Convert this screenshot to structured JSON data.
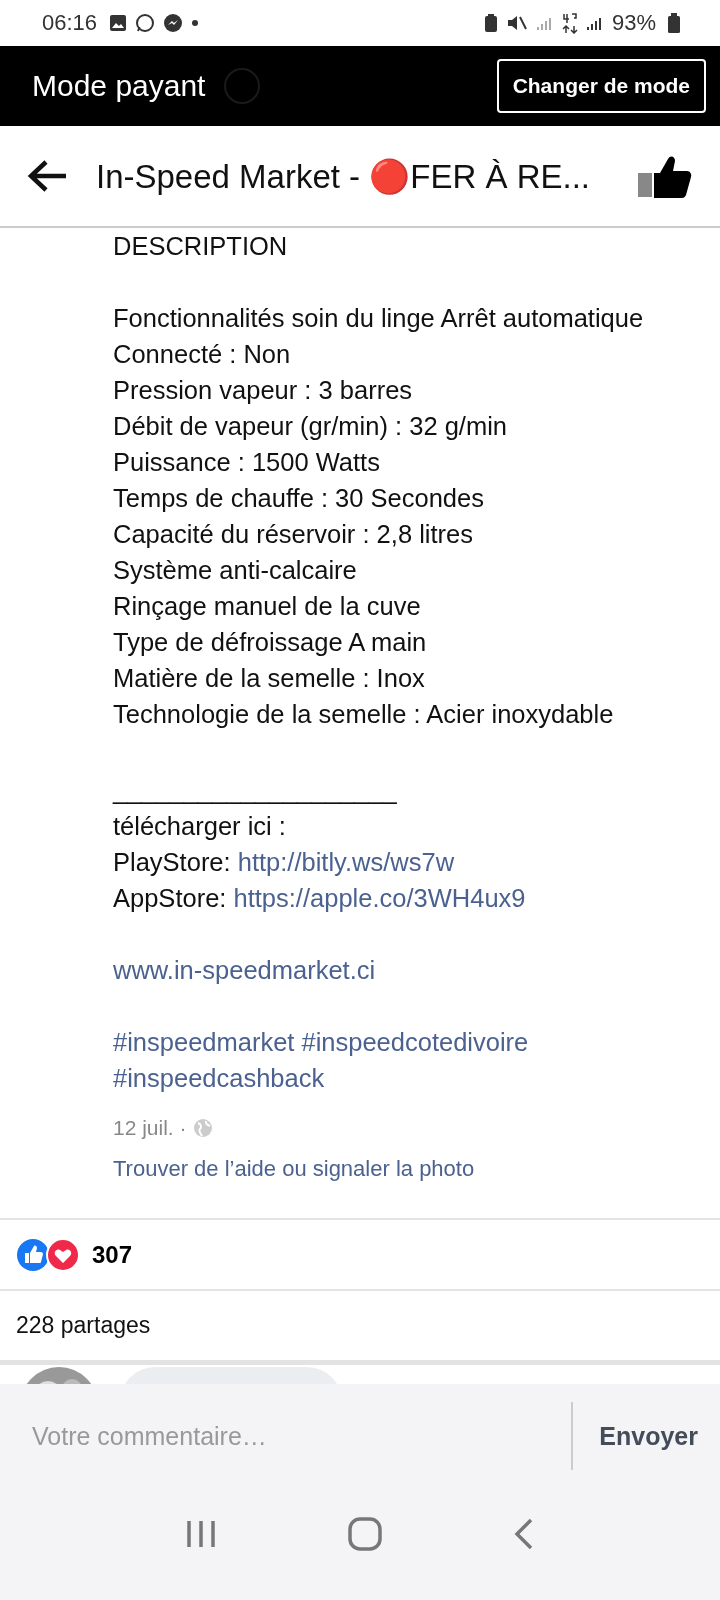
{
  "status_bar": {
    "time": "06:16",
    "battery": "93%"
  },
  "mode_bar": {
    "title": "Mode payant",
    "button": "Changer de mode"
  },
  "header": {
    "title": "In-Speed Market - 🔴FER À RE..."
  },
  "description": {
    "blocks": [
      {
        "lines": [
          {
            "label": "DESCRIPTION"
          }
        ]
      },
      {
        "lines": [
          {
            "label": "Fonctionnalités soin du linge Arrêt automatique"
          },
          {
            "label": "Connecté : Non"
          },
          {
            "label": "Pression vapeur : 3 barres"
          },
          {
            "label": "Débit de vapeur (gr/min) : 32 g/min"
          },
          {
            "label": "Puissance : 1500 Watts"
          },
          {
            "label": "Temps de chauffe : 30 Secondes"
          },
          {
            "label": "Capacité du réservoir : 2,8 litres"
          },
          {
            "label": "Système anti-calcaire"
          },
          {
            "label": "Rinçage manuel de la cuve"
          },
          {
            "label": "Type de défroissage A main"
          },
          {
            "label": "Matière de la semelle : Inox"
          },
          {
            "label": "Technologie de la semelle : Acier inoxydable"
          }
        ]
      },
      {
        "lines": [
          {
            "label": "____________________"
          },
          {
            "label": "télécharger ici :"
          },
          {
            "label": "PlayStore:",
            "link": "http://bitly.ws/ws7w"
          },
          {
            "label": "AppStore:",
            "link": "https://apple.co/3WH4ux9"
          }
        ]
      },
      {
        "lines": [
          {
            "link": "www.in-speedmarket.ci"
          }
        ]
      },
      {
        "lines": [
          {
            "tags": [
              "#inspeedmarket",
              "#inspeedcotedivoire"
            ]
          },
          {
            "tags": [
              "#inspeedcashback"
            ]
          }
        ]
      }
    ]
  },
  "meta": {
    "date": "12 juil. ·",
    "report_link": "Trouver de l’aide ou signaler la photo"
  },
  "reactions": {
    "count": "307"
  },
  "shares": "228 partages",
  "comment_box": {
    "placeholder": "Votre commentaire…",
    "send": "Envoyer"
  }
}
